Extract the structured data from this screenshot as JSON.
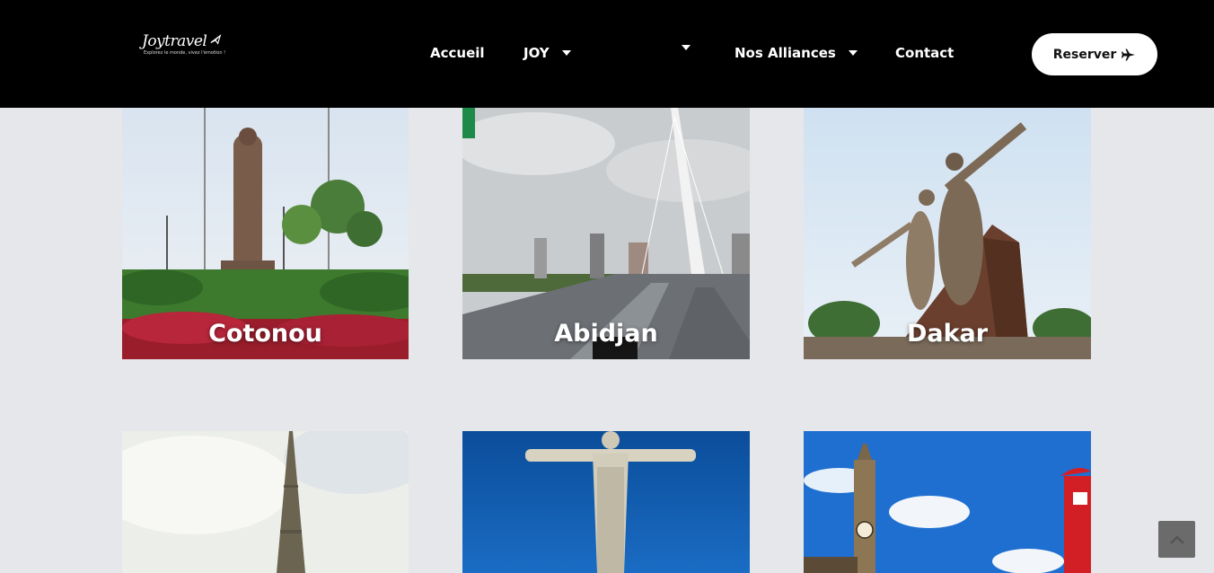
{
  "brand": {
    "name": "Joytravel",
    "tagline": "Explorez le monde, vivez l'émotion !",
    "icon": "plane-icon"
  },
  "nav": {
    "items": [
      {
        "label": "Accueil",
        "has_dropdown": false
      },
      {
        "label": "JOY",
        "has_dropdown": true
      },
      {
        "label": "",
        "has_dropdown": true
      },
      {
        "label": "Nos Alliances",
        "has_dropdown": true
      },
      {
        "label": "Contact",
        "has_dropdown": false
      }
    ],
    "cta_label": "Reserver",
    "cta_icon": "plane-icon"
  },
  "destinations": [
    {
      "name": "Cotonou"
    },
    {
      "name": "Abidjan"
    },
    {
      "name": "Dakar"
    },
    {
      "name": ""
    },
    {
      "name": ""
    },
    {
      "name": ""
    }
  ],
  "scroll_top": {
    "icon": "chevron-up-icon"
  },
  "colors": {
    "header_bg": "#000000",
    "page_bg": "#e5e7eb",
    "cta_bg": "#ffffff"
  }
}
